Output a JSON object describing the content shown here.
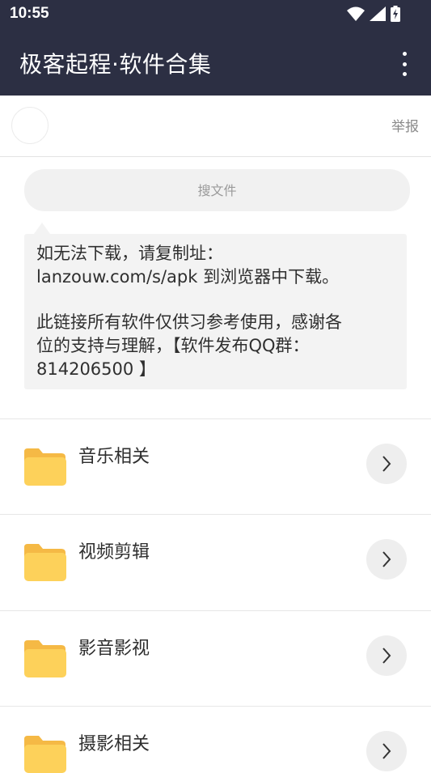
{
  "status_bar": {
    "time": "10:55",
    "icons": [
      "wifi-icon",
      "signal-icon",
      "battery-charging-icon"
    ]
  },
  "app_bar": {
    "title": "极客起程·软件合集",
    "menu_icon": "more-vert-icon"
  },
  "header": {
    "report_label": "举报"
  },
  "search": {
    "placeholder": "搜文件"
  },
  "notice": {
    "line1": "如无法下载，请复制址：",
    "line2": "lanzouw.com/s/apk 到浏览器中下载。",
    "line3": "此链接所有软件仅供习参考使用，感谢各",
    "line4": "位的支持与理解，【软件发布QQ群：",
    "line5": "814206500 】"
  },
  "folders": [
    {
      "label": "音乐相关"
    },
    {
      "label": "视频剪辑"
    },
    {
      "label": "影音影视"
    },
    {
      "label": "摄影相关"
    }
  ],
  "colors": {
    "app_bar": "#2c2f43",
    "folder": "#fdd15a",
    "folder_tab": "#f5b945"
  }
}
